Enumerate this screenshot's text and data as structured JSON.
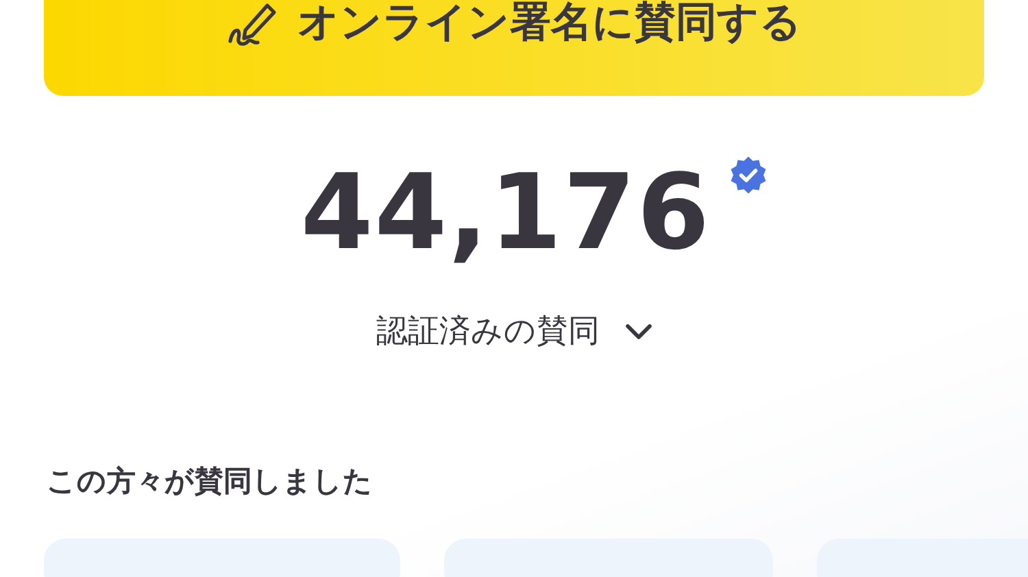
{
  "sign_button": {
    "label": "オンライン署名に賛同する"
  },
  "count": {
    "value": "44,176",
    "verified": true
  },
  "filter": {
    "label": "認証済みの賛同"
  },
  "supporters": {
    "heading": "この方々が賛同しました"
  }
}
